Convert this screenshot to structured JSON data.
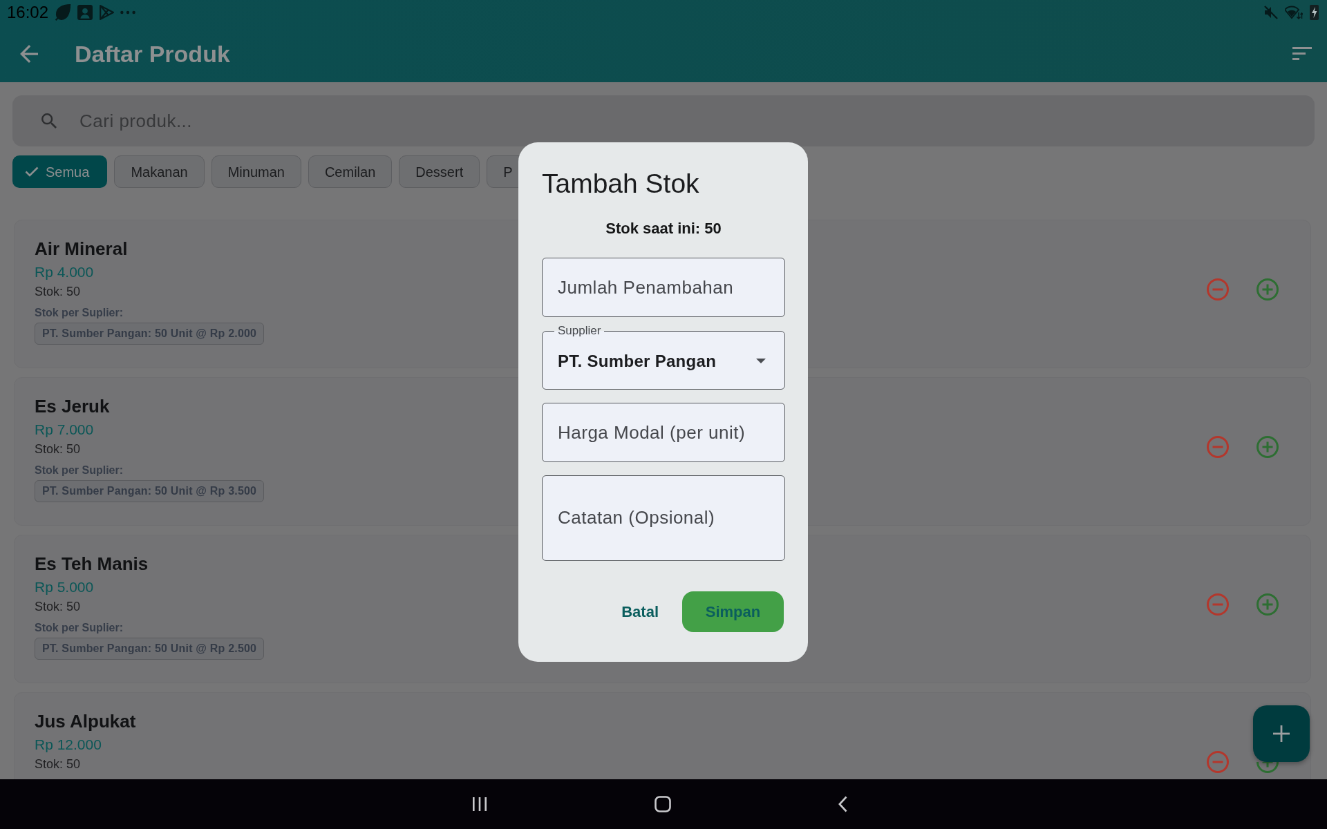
{
  "status_bar": {
    "time": "16:02"
  },
  "app_bar": {
    "title": "Daftar Produk"
  },
  "search": {
    "placeholder": "Cari produk..."
  },
  "filter_chips": [
    {
      "label": "Semua",
      "selected": true
    },
    {
      "label": "Makanan",
      "selected": false
    },
    {
      "label": "Minuman",
      "selected": false
    },
    {
      "label": "Cemilan",
      "selected": false
    },
    {
      "label": "Dessert",
      "selected": false
    },
    {
      "label": "P",
      "selected": false
    }
  ],
  "products": [
    {
      "name": "Air Mineral",
      "price": "Rp 4.000",
      "stock": "Stok: 50",
      "supplier_heading": "Stok per Suplier:",
      "supplier_stocks": [
        "PT. Sumber Pangan: 50 Unit @ Rp 2.000"
      ]
    },
    {
      "name": "Es Jeruk",
      "price": "Rp 7.000",
      "stock": "Stok: 50",
      "supplier_heading": "Stok per Suplier:",
      "supplier_stocks": [
        "PT. Sumber Pangan: 50 Unit @ Rp 3.500"
      ]
    },
    {
      "name": "Es Teh Manis",
      "price": "Rp 5.000",
      "stock": "Stok: 50",
      "supplier_heading": "Stok per Suplier:",
      "supplier_stocks": [
        "PT. Sumber Pangan: 50 Unit @ Rp 2.500"
      ]
    },
    {
      "name": "Jus Alpukat",
      "price": "Rp 12.000",
      "stock": "Stok: 50"
    }
  ],
  "dialog": {
    "title": "Tambah Stok",
    "current_stock": "Stok saat ini: 50",
    "fields": [
      {
        "kind": "text",
        "placeholder": "Jumlah Penambahan"
      },
      {
        "kind": "dropdown",
        "label": "Supplier",
        "value": "PT. Sumber Pangan"
      },
      {
        "kind": "text",
        "placeholder": "Harga Modal (per unit)"
      },
      {
        "kind": "multiline",
        "placeholder": "Catatan (Opsional)"
      }
    ],
    "buttons": [
      {
        "kind": "text",
        "label": "Batal"
      },
      {
        "kind": "filled",
        "label": "Simpan"
      }
    ]
  }
}
